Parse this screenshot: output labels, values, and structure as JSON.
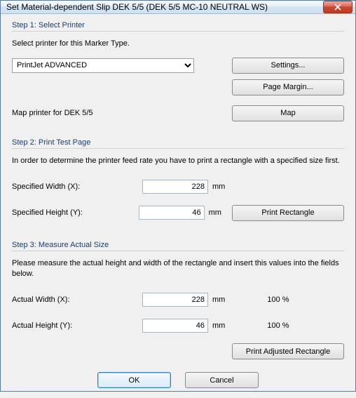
{
  "window": {
    "title": "Set Material-dependent Slip DEK 5/5 (DEK 5/5 MC-10 NEUTRAL WS)"
  },
  "step1": {
    "title": "Step 1: Select Printer",
    "instruction": "Select printer for this Marker Type.",
    "printer_value": "PrintJet ADVANCED",
    "settings_btn": "Settings...",
    "page_margin_btn": "Page Margin...",
    "map_label": "Map printer for DEK 5/5",
    "map_btn": "Map"
  },
  "step2": {
    "title": "Step 2: Print Test Page",
    "instruction": "In order to determine the printer feed rate you have to print a rectangle with a specified size first.",
    "width_label": "Specified Width (X):",
    "width_value": "228",
    "height_label": "Specified Height (Y):",
    "height_value": "46",
    "unit": "mm",
    "print_rect_btn": "Print Rectangle"
  },
  "step3": {
    "title": "Step 3: Measure Actual Size",
    "instruction": "Please measure the actual height and width of the rectangle and insert this values into the fields below.",
    "width_label": "Actual Width (X):",
    "width_value": "228",
    "width_pct": "100 %",
    "height_label": "Actual Height (Y):",
    "height_value": "46",
    "height_pct": "100 %",
    "unit": "mm",
    "print_adj_btn": "Print Adjusted Rectangle"
  },
  "footer": {
    "ok": "OK",
    "cancel": "Cancel"
  }
}
